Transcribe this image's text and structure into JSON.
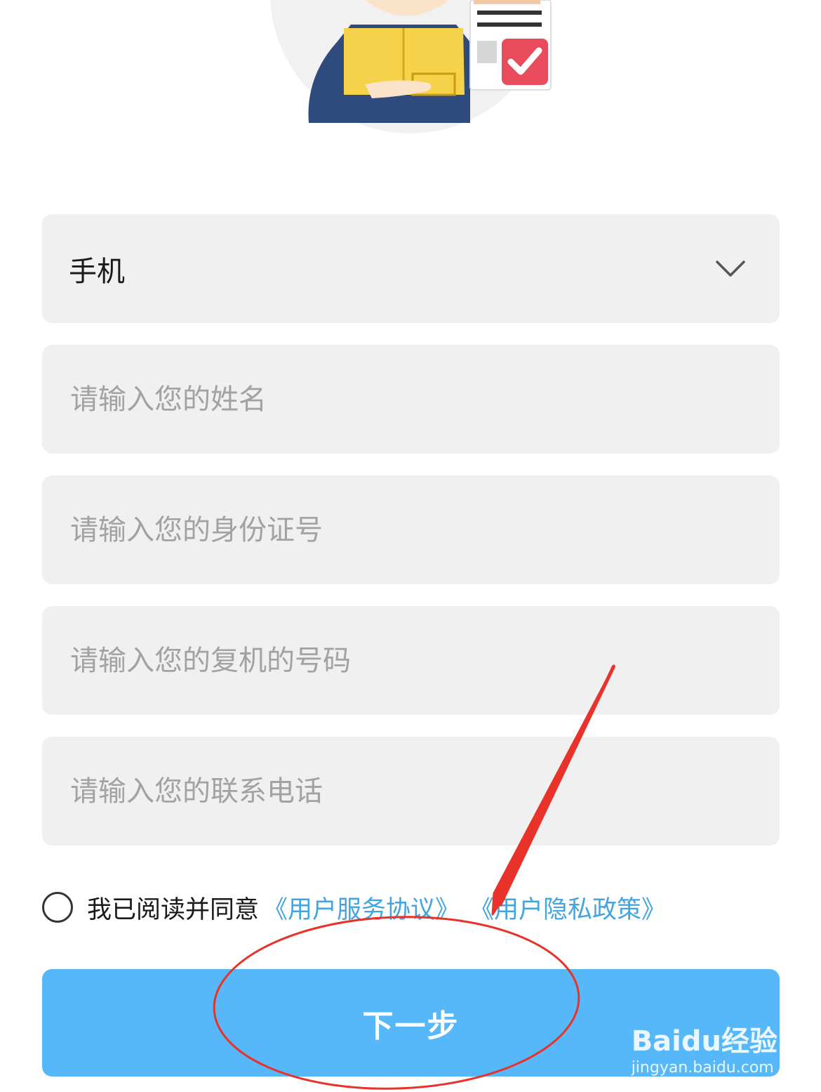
{
  "form": {
    "select": {
      "value": "手机"
    },
    "name_input": {
      "placeholder": "请输入您的姓名"
    },
    "id_input": {
      "placeholder": "请输入您的身份证号"
    },
    "copy_number_input": {
      "placeholder": "请输入您的复机的号码"
    },
    "phone_input": {
      "placeholder": "请输入您的联系电话"
    }
  },
  "agreement": {
    "text": "我已阅读并同意",
    "service_link": "《用户服务协议》",
    "privacy_link": "《用户隐私政策》"
  },
  "next_button": {
    "label": "下一步"
  },
  "watermark": {
    "brand": "Baidu经验",
    "url": "jingyan.baidu.com"
  },
  "colors": {
    "field_bg": "#f0f0f0",
    "placeholder": "#a2a2a2",
    "link": "#42a5e0",
    "button": "#56b8f8",
    "annotation": "#e8322a"
  }
}
